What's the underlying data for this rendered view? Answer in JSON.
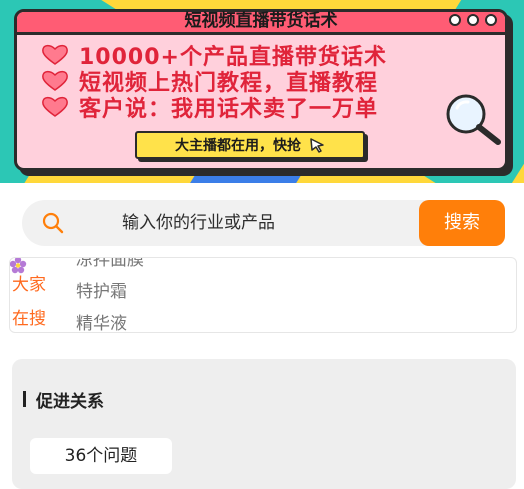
{
  "banner": {
    "window_title": "短视频直播带货话术",
    "lines": [
      "10000+个产品直播带货话术",
      "短视频上热门教程，直播教程",
      "客户说：我用话术卖了一万单"
    ],
    "cta_label": "大主播都在用，快抢"
  },
  "search": {
    "placeholder": "输入你的行业或产品",
    "button_label": "搜索"
  },
  "trending": {
    "label_line1": "大家",
    "label_line2": "在搜",
    "items": [
      "凉拌面膜",
      "特护霜",
      "精华液"
    ]
  },
  "category": {
    "title": "促进关系",
    "count_label": "36个问题"
  },
  "colors": {
    "accent": "#ff7f0a",
    "banner_yellow": "#ffd83a",
    "banner_pink": "#ffd0dc",
    "headline_red": "#e0243a",
    "trend_orange": "#ff6a1f"
  }
}
